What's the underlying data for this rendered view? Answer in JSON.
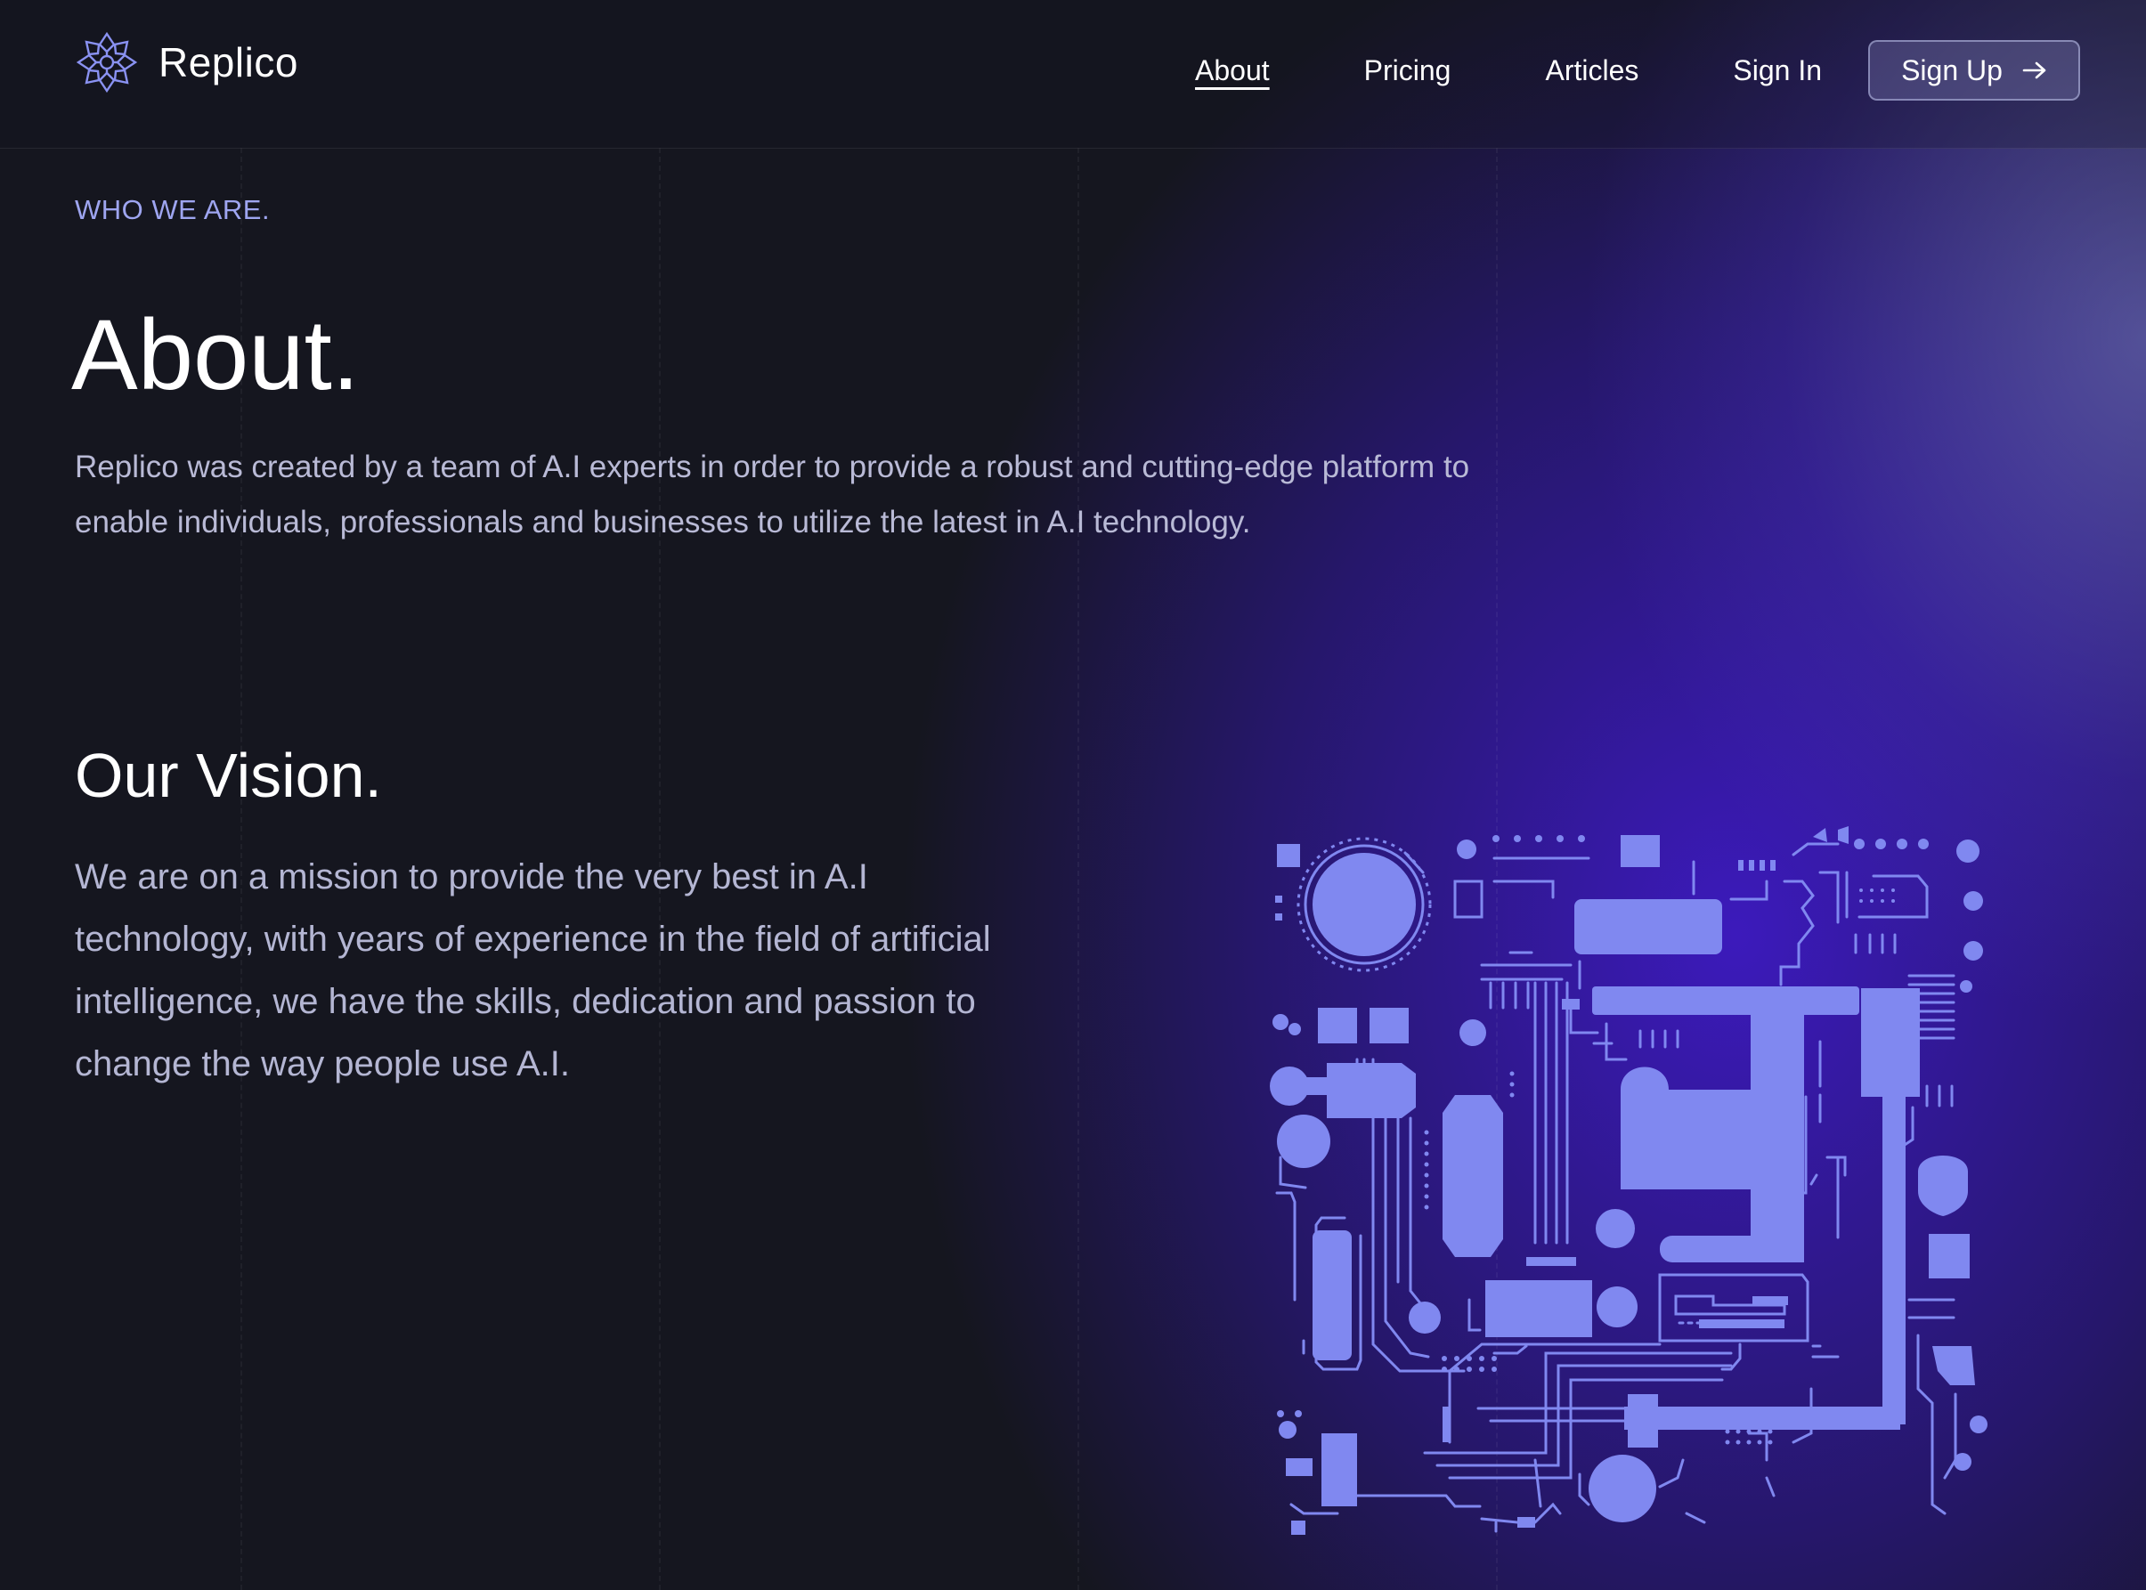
{
  "brand": {
    "name": "Replico",
    "logo_icon": "snowflake-ornament-icon"
  },
  "nav": {
    "links": [
      "About",
      "Pricing",
      "Articles",
      "Sign In"
    ],
    "active": "About",
    "signup": "Sign Up",
    "signup_icon": "arrow-right-icon"
  },
  "hero": {
    "eyebrow": "WHO WE ARE.",
    "title": "About.",
    "text": "Replico was created by a team of A.I experts in order to provide a robust and cutting-edge platform to enable individuals, professionals and businesses to utilize the latest in A.I technology."
  },
  "vision": {
    "title": "Our Vision.",
    "text": "We are on a mission to provide the very best in A.I technology, with years of experience in the field of artificial intelligence, we have the skills, dedication and passion to change the way people use A.I.",
    "illustration": "circuit-board-illustration"
  },
  "colors": {
    "background": "#15161f",
    "accent": "#8088f0",
    "glow": "#3e1ac4",
    "eyebrow": "#9ea5f0",
    "body_text": "#b9bad6"
  }
}
